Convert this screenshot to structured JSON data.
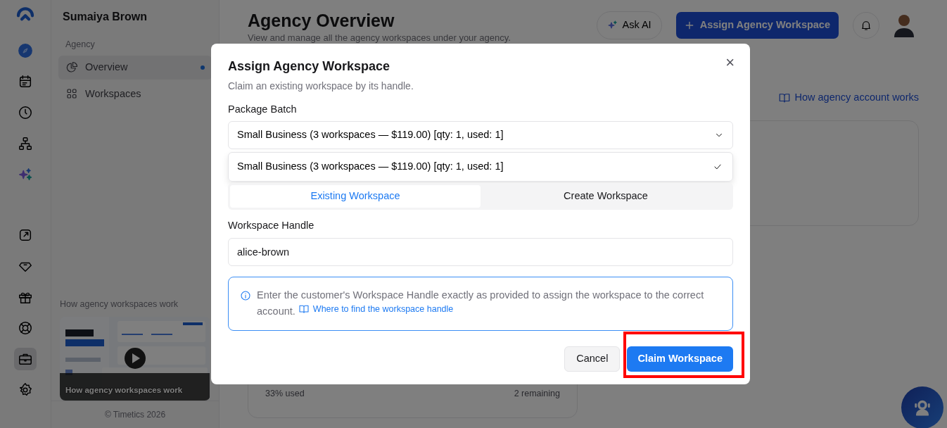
{
  "rail": {
    "items": [
      {
        "selected": false
      },
      {
        "selected": false
      },
      {
        "selected": false
      },
      {
        "selected": false
      },
      {
        "selected": false
      },
      {
        "selected": false
      },
      {
        "selected": false
      },
      {
        "selected": false
      },
      {
        "selected": false
      },
      {
        "selected": true
      },
      {
        "selected": false
      }
    ]
  },
  "sidebar": {
    "user": "Sumaiya Brown",
    "section": "Agency",
    "items": [
      {
        "label": "Overview",
        "selected": true
      },
      {
        "label": "Workspaces",
        "selected": false
      }
    ],
    "video": {
      "heading": "How agency workspaces work",
      "caption": "How agency workspaces work"
    },
    "footer": "© Timetics 2026"
  },
  "header": {
    "title": "Agency Overview",
    "subtitle": "View and manage all the agency workspaces under your agency.",
    "ask_ai": "Ask AI",
    "assign_button": "Assign Agency Workspace",
    "help_link": "How agency account works"
  },
  "usage_card": {
    "used": "33% used",
    "remaining": "2 remaining"
  },
  "dialog": {
    "title": "Assign Agency Workspace",
    "subtitle": "Claim an existing workspace by its handle.",
    "close": "×",
    "package": {
      "label": "Package Batch",
      "value": "Small Business (3 workspaces — $119.00) [qty: 1, used: 1]",
      "expanded": true,
      "options": [
        {
          "label": "Small Business (3 workspaces — $119.00) [qty: 1, used: 1]",
          "selected": true
        }
      ]
    },
    "tabs": [
      {
        "label": "Existing Workspace",
        "selected": true
      },
      {
        "label": "Create Workspace",
        "selected": false
      }
    ],
    "handle": {
      "label": "Workspace Handle",
      "value": "alice-brown"
    },
    "info": {
      "text": "Enter the customer's Workspace Handle exactly as provided to assign the workspace to the correct account.",
      "link": "Where to find the workspace handle"
    },
    "buttons": [
      {
        "label": "Cancel",
        "kind": "secondary"
      },
      {
        "label": "Claim Workspace",
        "kind": "primary",
        "highlighted": true
      }
    ]
  }
}
